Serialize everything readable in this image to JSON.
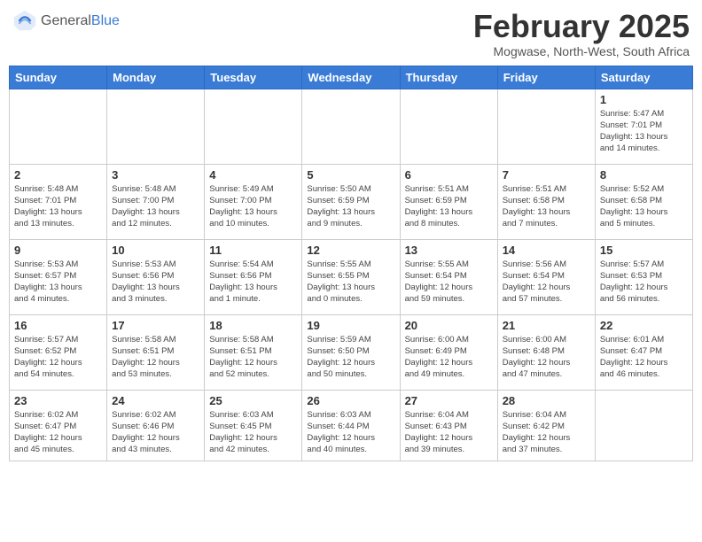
{
  "header": {
    "logo_general": "General",
    "logo_blue": "Blue",
    "month_title": "February 2025",
    "location": "Mogwase, North-West, South Africa"
  },
  "weekdays": [
    "Sunday",
    "Monday",
    "Tuesday",
    "Wednesday",
    "Thursday",
    "Friday",
    "Saturday"
  ],
  "weeks": [
    [
      {
        "day": "",
        "info": ""
      },
      {
        "day": "",
        "info": ""
      },
      {
        "day": "",
        "info": ""
      },
      {
        "day": "",
        "info": ""
      },
      {
        "day": "",
        "info": ""
      },
      {
        "day": "",
        "info": ""
      },
      {
        "day": "1",
        "info": "Sunrise: 5:47 AM\nSunset: 7:01 PM\nDaylight: 13 hours\nand 14 minutes."
      }
    ],
    [
      {
        "day": "2",
        "info": "Sunrise: 5:48 AM\nSunset: 7:01 PM\nDaylight: 13 hours\nand 13 minutes."
      },
      {
        "day": "3",
        "info": "Sunrise: 5:48 AM\nSunset: 7:00 PM\nDaylight: 13 hours\nand 12 minutes."
      },
      {
        "day": "4",
        "info": "Sunrise: 5:49 AM\nSunset: 7:00 PM\nDaylight: 13 hours\nand 10 minutes."
      },
      {
        "day": "5",
        "info": "Sunrise: 5:50 AM\nSunset: 6:59 PM\nDaylight: 13 hours\nand 9 minutes."
      },
      {
        "day": "6",
        "info": "Sunrise: 5:51 AM\nSunset: 6:59 PM\nDaylight: 13 hours\nand 8 minutes."
      },
      {
        "day": "7",
        "info": "Sunrise: 5:51 AM\nSunset: 6:58 PM\nDaylight: 13 hours\nand 7 minutes."
      },
      {
        "day": "8",
        "info": "Sunrise: 5:52 AM\nSunset: 6:58 PM\nDaylight: 13 hours\nand 5 minutes."
      }
    ],
    [
      {
        "day": "9",
        "info": "Sunrise: 5:53 AM\nSunset: 6:57 PM\nDaylight: 13 hours\nand 4 minutes."
      },
      {
        "day": "10",
        "info": "Sunrise: 5:53 AM\nSunset: 6:56 PM\nDaylight: 13 hours\nand 3 minutes."
      },
      {
        "day": "11",
        "info": "Sunrise: 5:54 AM\nSunset: 6:56 PM\nDaylight: 13 hours\nand 1 minute."
      },
      {
        "day": "12",
        "info": "Sunrise: 5:55 AM\nSunset: 6:55 PM\nDaylight: 13 hours\nand 0 minutes."
      },
      {
        "day": "13",
        "info": "Sunrise: 5:55 AM\nSunset: 6:54 PM\nDaylight: 12 hours\nand 59 minutes."
      },
      {
        "day": "14",
        "info": "Sunrise: 5:56 AM\nSunset: 6:54 PM\nDaylight: 12 hours\nand 57 minutes."
      },
      {
        "day": "15",
        "info": "Sunrise: 5:57 AM\nSunset: 6:53 PM\nDaylight: 12 hours\nand 56 minutes."
      }
    ],
    [
      {
        "day": "16",
        "info": "Sunrise: 5:57 AM\nSunset: 6:52 PM\nDaylight: 12 hours\nand 54 minutes."
      },
      {
        "day": "17",
        "info": "Sunrise: 5:58 AM\nSunset: 6:51 PM\nDaylight: 12 hours\nand 53 minutes."
      },
      {
        "day": "18",
        "info": "Sunrise: 5:58 AM\nSunset: 6:51 PM\nDaylight: 12 hours\nand 52 minutes."
      },
      {
        "day": "19",
        "info": "Sunrise: 5:59 AM\nSunset: 6:50 PM\nDaylight: 12 hours\nand 50 minutes."
      },
      {
        "day": "20",
        "info": "Sunrise: 6:00 AM\nSunset: 6:49 PM\nDaylight: 12 hours\nand 49 minutes."
      },
      {
        "day": "21",
        "info": "Sunrise: 6:00 AM\nSunset: 6:48 PM\nDaylight: 12 hours\nand 47 minutes."
      },
      {
        "day": "22",
        "info": "Sunrise: 6:01 AM\nSunset: 6:47 PM\nDaylight: 12 hours\nand 46 minutes."
      }
    ],
    [
      {
        "day": "23",
        "info": "Sunrise: 6:02 AM\nSunset: 6:47 PM\nDaylight: 12 hours\nand 45 minutes."
      },
      {
        "day": "24",
        "info": "Sunrise: 6:02 AM\nSunset: 6:46 PM\nDaylight: 12 hours\nand 43 minutes."
      },
      {
        "day": "25",
        "info": "Sunrise: 6:03 AM\nSunset: 6:45 PM\nDaylight: 12 hours\nand 42 minutes."
      },
      {
        "day": "26",
        "info": "Sunrise: 6:03 AM\nSunset: 6:44 PM\nDaylight: 12 hours\nand 40 minutes."
      },
      {
        "day": "27",
        "info": "Sunrise: 6:04 AM\nSunset: 6:43 PM\nDaylight: 12 hours\nand 39 minutes."
      },
      {
        "day": "28",
        "info": "Sunrise: 6:04 AM\nSunset: 6:42 PM\nDaylight: 12 hours\nand 37 minutes."
      },
      {
        "day": "",
        "info": ""
      }
    ]
  ]
}
